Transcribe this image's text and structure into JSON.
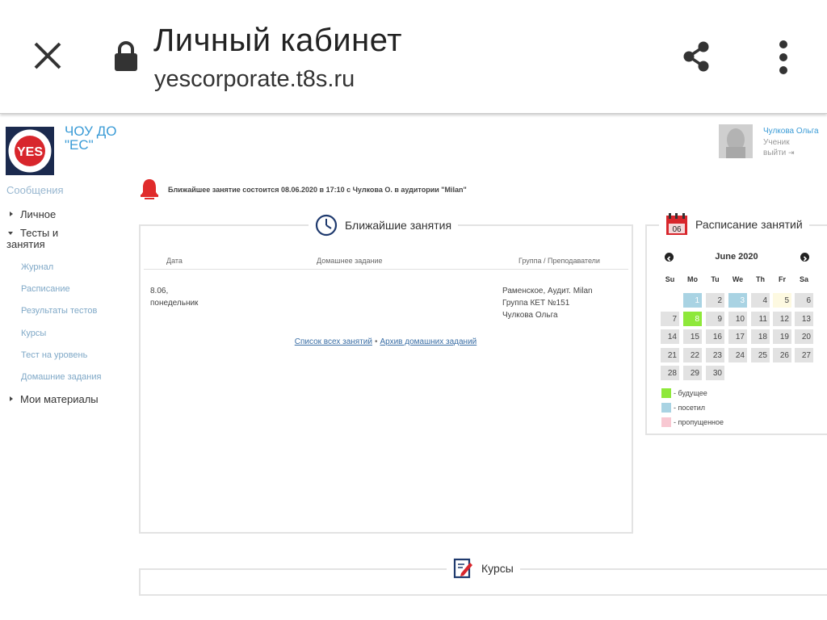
{
  "browser": {
    "title": "Личный кабинет",
    "url": "yescorporate.t8s.ru"
  },
  "org": {
    "name": "ЧОУ ДО \"ЕС\""
  },
  "sidebar": {
    "messages": "Сообщения",
    "items": [
      {
        "label": "Личное"
      },
      {
        "label": "Тесты и занятия"
      },
      {
        "label": "Мои материалы"
      }
    ],
    "subitems": [
      {
        "label": "Журнал"
      },
      {
        "label": "Расписание"
      },
      {
        "label": "Результаты тестов"
      },
      {
        "label": "Курсы"
      },
      {
        "label": "Тест на уровень"
      },
      {
        "label": "Домашние задания"
      }
    ]
  },
  "user": {
    "name": "Чулкова Ольга",
    "role": "Ученик",
    "logout": "выйти"
  },
  "notice": {
    "text": "Ближайшее занятие состоится 08.06.2020 в 17:10 с Чулкова О. в аудитории \"Milan\""
  },
  "lessons": {
    "title": "Ближайшие занятия",
    "headers": {
      "date": "Дата",
      "homework": "Домашнее задание",
      "group": "Группа / Преподаватели"
    },
    "rows": [
      {
        "date_line1": "8.06,",
        "date_line2": "понедельник",
        "homework": "",
        "group_line1": "Раменское, Аудит. Milan",
        "group_line2": "Группа КЕТ №151",
        "group_line3": "Чулкова Ольга"
      }
    ],
    "link_all": "Список всех занятий",
    "link_archive": "Архив домашних заданий"
  },
  "schedule": {
    "title": "Расписание занятий",
    "icon_day": "06",
    "month": "June 2020",
    "dow": [
      "Su",
      "Mo",
      "Tu",
      "We",
      "Th",
      "Fr",
      "Sa"
    ],
    "weeks": [
      [
        "",
        "1",
        "2",
        "3",
        "4",
        "5",
        "6"
      ],
      [
        "7",
        "8",
        "9",
        "10",
        "11",
        "12",
        "13"
      ],
      [
        "14",
        "15",
        "16",
        "17",
        "18",
        "19",
        "20"
      ],
      [
        "21",
        "22",
        "23",
        "24",
        "25",
        "26",
        "27"
      ],
      [
        "28",
        "29",
        "30",
        "",
        "",
        "",
        ""
      ]
    ],
    "marks": {
      "visited": [
        "1",
        "3"
      ],
      "future": [
        "8"
      ],
      "today": [
        "5"
      ]
    },
    "colors": {
      "future": "#8ee83a",
      "visited": "#a9d3e3",
      "missed": "#f8c8d2",
      "today": "#fdf9e1",
      "default": "#e2e2e2"
    },
    "legend": [
      {
        "key": "future",
        "label": "- будущее"
      },
      {
        "key": "visited",
        "label": "- посетил"
      },
      {
        "key": "missed",
        "label": "- пропущенное"
      }
    ]
  },
  "courses": {
    "title": "Курсы"
  }
}
